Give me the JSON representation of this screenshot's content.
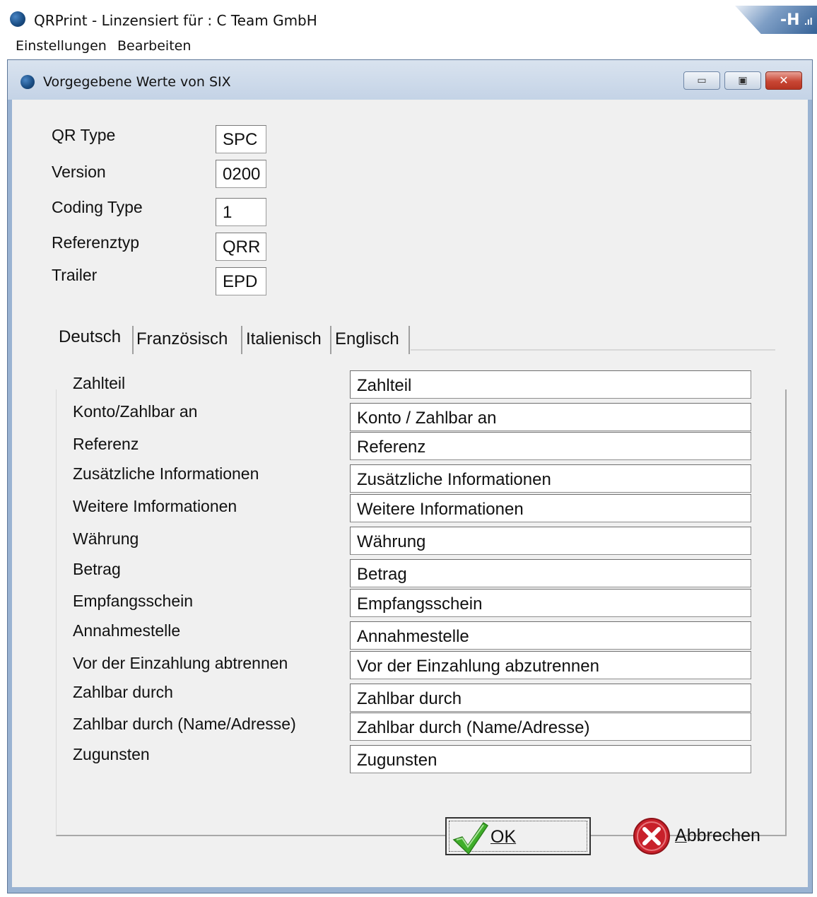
{
  "app": {
    "title": "QRPrint - Linzensiert für : C Team GmbH",
    "menu": [
      "Einstellungen",
      "Bearbeiten"
    ]
  },
  "dialog": {
    "title": "Vorgegebene Werte von SIX",
    "header_fields": [
      {
        "label": "QR Type",
        "value": "SPC"
      },
      {
        "label": "Version",
        "value": "0200"
      },
      {
        "label": "Coding Type",
        "value": "1"
      },
      {
        "label": "Referenztyp",
        "value": "QRR"
      },
      {
        "label": "Trailer",
        "value": "EPD"
      }
    ],
    "tabs": [
      {
        "label": "Deutsch",
        "active": true
      },
      {
        "label": "Französisch",
        "active": false
      },
      {
        "label": "Italienisch",
        "active": false
      },
      {
        "label": "Englisch",
        "active": false
      }
    ],
    "rows": [
      {
        "label": "Zahlteil",
        "value": "Zahlteil"
      },
      {
        "label": "Konto/Zahlbar an",
        "value": "Konto / Zahlbar an"
      },
      {
        "label": "Referenz",
        "value": "Referenz"
      },
      {
        "label": "Zusätzliche Informationen",
        "value": "Zusätzliche Informationen"
      },
      {
        "label": "Weitere Imformationen",
        "value": "Weitere Informationen"
      },
      {
        "label": "Währung",
        "value": "Währung"
      },
      {
        "label": "Betrag",
        "value": "Betrag"
      },
      {
        "label": "Empfangsschein",
        "value": "Empfangsschein"
      },
      {
        "label": "Annahmestelle",
        "value": "Annahmestelle"
      },
      {
        "label": "Vor der Einzahlung abtrennen",
        "value": "Vor der Einzahlung abzutrennen"
      },
      {
        "label": "Zahlbar durch",
        "value": "Zahlbar durch"
      },
      {
        "label": "Zahlbar durch (Name/Adresse)",
        "value": "Zahlbar durch (Name/Adresse)"
      },
      {
        "label": "Zugunsten",
        "value": "Zugunsten"
      }
    ],
    "ok_label": "OK",
    "cancel_mnemonic": "A",
    "cancel_rest": "bbrechen"
  },
  "icons": {
    "app": "app-logo-icon",
    "ok": "check-icon",
    "cancel": "x-circle-icon"
  },
  "colors": {
    "title_blue": "#1b4f86",
    "dialog_frame": "#9ab3d2",
    "close_red": "#c84634",
    "check_green": "#3fae2a",
    "cancel_red": "#c8202a"
  }
}
